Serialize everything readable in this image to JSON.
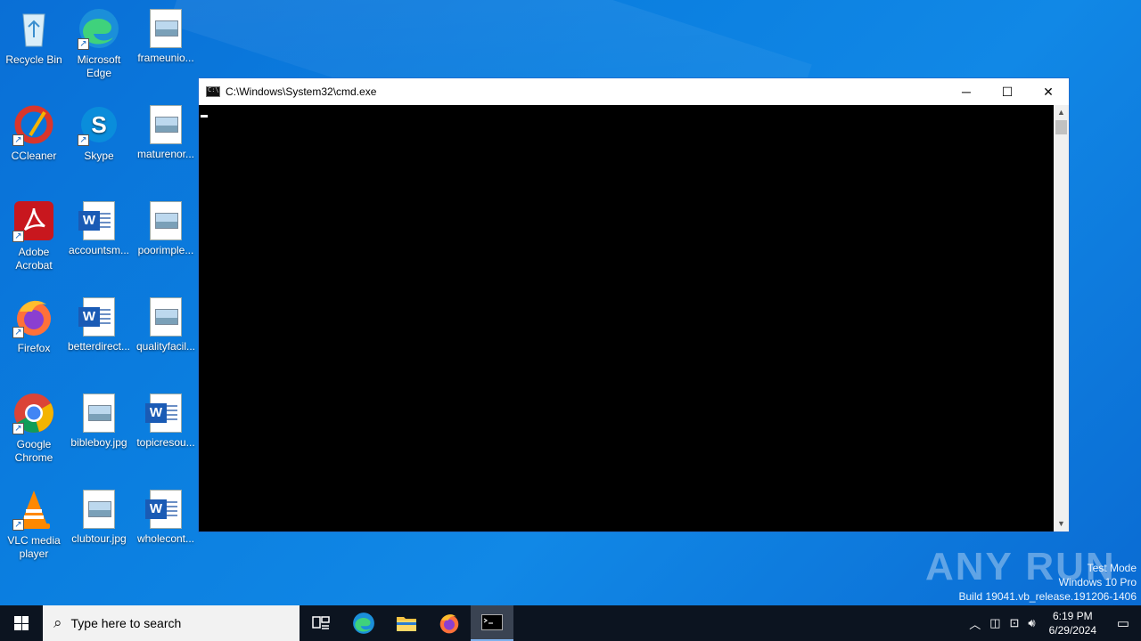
{
  "desktop": {
    "icons": [
      {
        "label": "Recycle Bin"
      },
      {
        "label": "Microsoft Edge"
      },
      {
        "label": "frameunio..."
      },
      {
        "label": "CCleaner"
      },
      {
        "label": "Skype"
      },
      {
        "label": "maturenor..."
      },
      {
        "label": "Adobe Acrobat"
      },
      {
        "label": "accountsm..."
      },
      {
        "label": "poorimple..."
      },
      {
        "label": "Firefox"
      },
      {
        "label": "betterdirect..."
      },
      {
        "label": "qualityfacil..."
      },
      {
        "label": "Google Chrome"
      },
      {
        "label": "bibleboy.jpg"
      },
      {
        "label": "topicresou..."
      },
      {
        "label": "VLC media player"
      },
      {
        "label": "clubtour.jpg"
      },
      {
        "label": "wholecont..."
      }
    ]
  },
  "window": {
    "title": "C:\\Windows\\System32\\cmd.exe",
    "minimize": "─",
    "maximize": "☐",
    "close": "✕"
  },
  "watermark": {
    "brand": "ANY RUN",
    "line1": "Test Mode",
    "line2": "Windows 10 Pro",
    "line3": "Build 19041.vb_release.191206-1406"
  },
  "taskbar": {
    "search_placeholder": "Type here to search",
    "time": "6:19 PM",
    "date": "6/29/2024"
  },
  "colors": {
    "desktop": "#0b7fe0",
    "taskbar": "#0c1420",
    "console": "#000000"
  }
}
